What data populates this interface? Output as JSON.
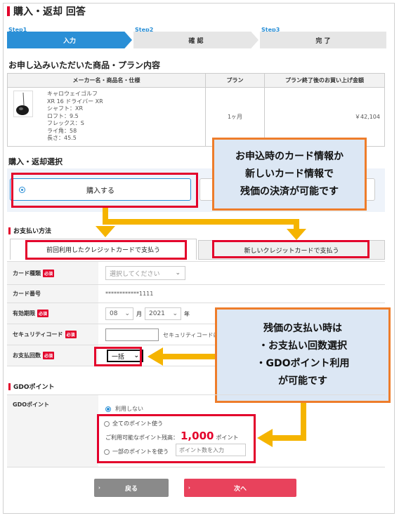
{
  "page_title": "購入・返却 回答",
  "steps": [
    {
      "label": "Step1",
      "name": "入力"
    },
    {
      "label": "Step2",
      "name": "確 認"
    },
    {
      "label": "Step3",
      "name": "完 了"
    }
  ],
  "product_section": {
    "title": "お申し込みいただいた商品・プラン内容",
    "headers": [
      "メーカー名・商品名・仕様",
      "プラン",
      "プラン終了後のお買い上げ金額"
    ],
    "product": {
      "maker": "キャロウェイゴルフ",
      "name": "XR 16 ドライバー XR",
      "shaft": "シャフト：XR",
      "loft": "ロフト：9.5",
      "flex": "フレックス：S",
      "lie": "ライ角：58",
      "length": "長さ：45.5",
      "plan": "1ヶ月",
      "price": "￥42,104"
    }
  },
  "purchase_section": {
    "title": "購入・返却選択",
    "option_buy": "購入する"
  },
  "payment_section": {
    "title": "お支払い方法",
    "tab_previous": "前回利用したクレジットカードで支払う",
    "tab_new": "新しいクレジットカードで支払う",
    "required": "必須",
    "card_type_label": "カード種類",
    "card_type_value": "選択してください",
    "card_number_label": "カード番号",
    "card_number_value": "************1111",
    "expiry_label": "有効期限",
    "expiry_month": "08",
    "month_unit": "月",
    "expiry_year": "2021",
    "year_unit": "年",
    "security_label": "セキュリティコード",
    "security_hint": "セキュリティコードに",
    "installments_label": "お支払回数",
    "installments_value": "一括"
  },
  "gdo_section": {
    "title": "GDOポイント",
    "label": "GDOポイント",
    "opt_none": "利用しない",
    "opt_all": "全てのポイント使う",
    "available_prefix": "ご利用可能なポイント残高：",
    "available_value": "1,000",
    "available_unit": "ポイント",
    "opt_partial": "一部のポイントを使う",
    "partial_placeholder": "ポイント数を入力"
  },
  "buttons": {
    "back": "戻る",
    "next": "次へ"
  },
  "callouts": {
    "card": [
      "お申込時のカード情報か",
      "新しいカード情報で",
      "残価の決済が可能です"
    ],
    "payment": [
      "残価の支払い時は",
      "・お支払い回数選択",
      "・GDOポイント利用",
      "が可能です"
    ]
  },
  "colors": {
    "accent_blue": "#2a8fd6",
    "red": "#e3002b",
    "callout_border": "#ee7d2b",
    "callout_bg": "#dce7f4",
    "arrow": "#f5b400"
  }
}
